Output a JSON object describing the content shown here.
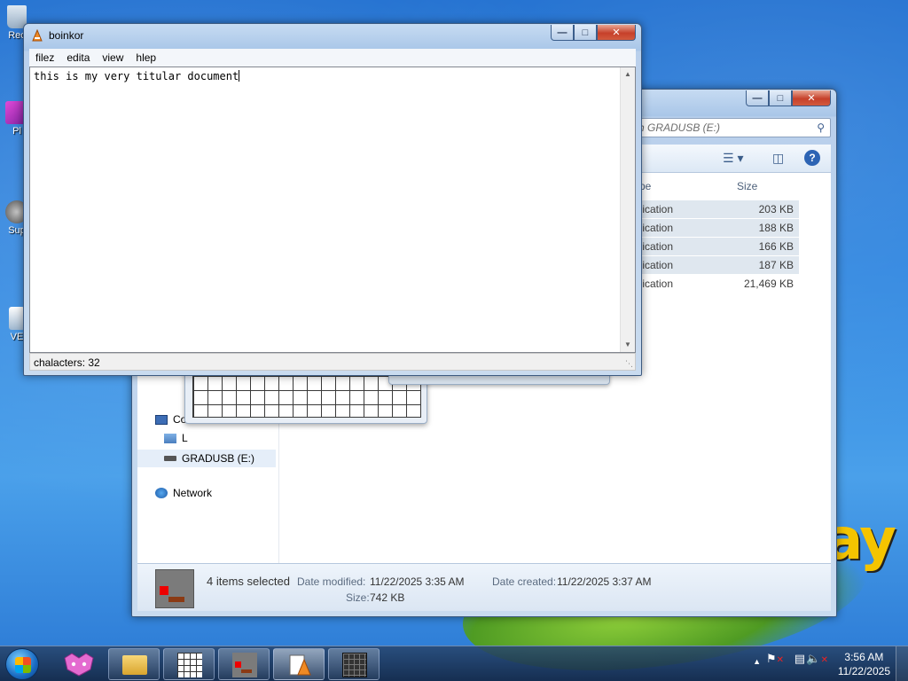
{
  "desktop": {
    "wallpaper_text": "ay",
    "icons": [
      {
        "label": "Rec",
        "icon": "recycle-bin-icon"
      },
      {
        "label": "Pl",
        "icon": "media-player-icon"
      },
      {
        "label": "Sup",
        "icon": "support-icon"
      },
      {
        "label": "VE",
        "icon": "ve-icon"
      }
    ]
  },
  "explorer": {
    "search_placeholder": "ch GRADUSB (E:)",
    "columns": {
      "type": "pe",
      "size": "Size"
    },
    "files": [
      {
        "type": "plication",
        "size": "203 KB",
        "selected": true
      },
      {
        "type": "plication",
        "size": "188 KB",
        "selected": true
      },
      {
        "type": "plication",
        "size": "166 KB",
        "selected": true
      },
      {
        "type": "plication",
        "size": "187 KB",
        "selected": true
      },
      {
        "type": "plication",
        "size": "21,469 KB",
        "selected": false
      }
    ],
    "nav": {
      "computer": "Co",
      "local_disk": "L",
      "drive": "GRADUSB (E:)",
      "network": "Network"
    },
    "details": {
      "selected_count": "4 items selected",
      "date_modified_label": "Date modified:",
      "date_modified": "11/22/2025 3:35 AM",
      "date_created_label": "Date created:",
      "date_created": "11/22/2025 3:37 AM",
      "size_label": "Size:",
      "size": "742 KB"
    }
  },
  "notepad": {
    "title": "boinkor",
    "menu": [
      "filez",
      "edita",
      "view",
      "hlep"
    ],
    "content": "this is my very titular document",
    "status": "chalacters: 32"
  },
  "taskbar": {
    "clock_time": "3:56 AM",
    "clock_date": "11/22/2025",
    "buttons": [
      "firefox-icon",
      "file-explorer-icon",
      "grid-app-icon",
      "paint-app-icon",
      "notepad-icon",
      "calculator-icon"
    ]
  },
  "colors": {
    "accent": "#2d64b4",
    "close": "#c6402a",
    "selection": "#dfe7ef"
  }
}
